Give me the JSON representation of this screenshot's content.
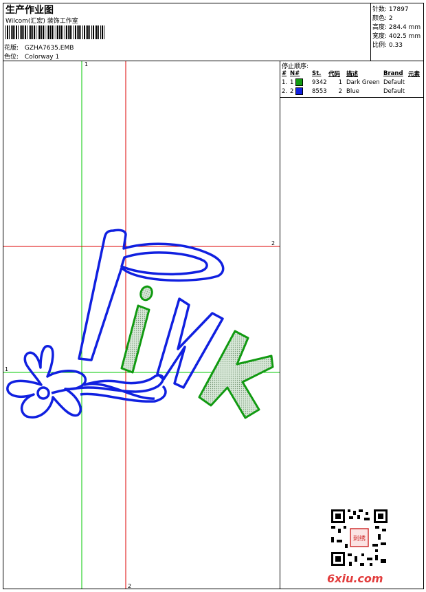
{
  "header": {
    "title": "生产作业图",
    "company": "Wilcom(汇宏) 装饰工作室",
    "design_file_label": "花版:",
    "design_file": "GZHA7635.EMB",
    "colorway_label": "色位:",
    "colorway": "Colorway 1"
  },
  "stats": [
    {
      "label": "针数:",
      "value": "17897"
    },
    {
      "label": "颜色:",
      "value": "2"
    },
    {
      "label": "高度:",
      "value": "284.4 mm"
    },
    {
      "label": "宽度:",
      "value": "402.5 mm"
    },
    {
      "label": "比例:",
      "value": "0.33"
    }
  ],
  "stop_sequence": {
    "title": "停止顺序:",
    "columns": [
      "#",
      "N#",
      "St.",
      "代码",
      "描述",
      "Brand",
      "元素"
    ],
    "rows": [
      {
        "index": "1.",
        "n": "1",
        "color": "#119a11",
        "st": "9342",
        "code": "1",
        "desc": "Dark Green",
        "brand": "Default"
      },
      {
        "index": "2.",
        "n": "2",
        "color": "#1020e0",
        "st": "8553",
        "code": "2",
        "desc": "Blue",
        "brand": "Default"
      }
    ]
  },
  "axes": {
    "green_v_label": "1",
    "green_h_label": "1",
    "red_h_label": "2",
    "red_v_label": "2"
  },
  "colors": {
    "green_thread": "#119a11",
    "blue_thread": "#1020e0",
    "guide_green": "#00c800",
    "guide_red": "#dd0000"
  },
  "watermark": {
    "site": "6xiu.com",
    "stamp": "刺绣"
  }
}
